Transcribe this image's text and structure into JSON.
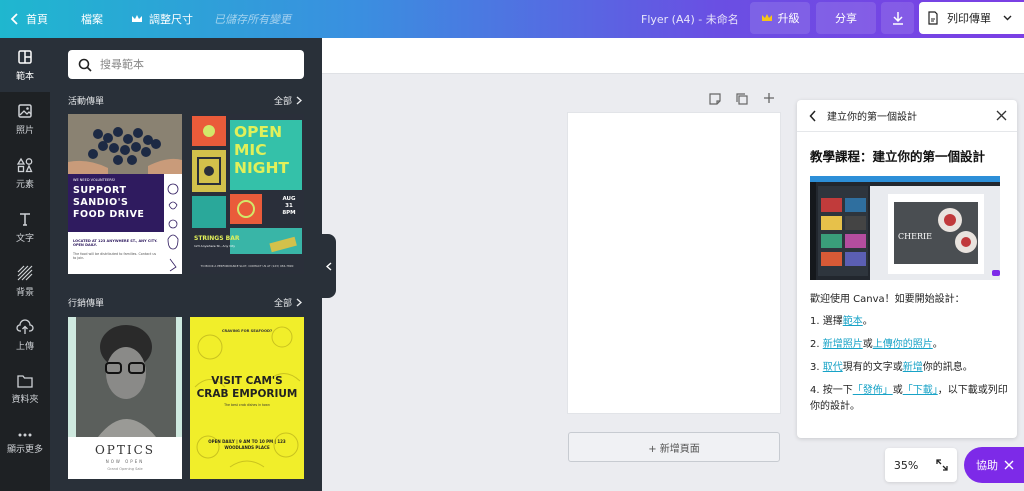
{
  "topbar": {
    "home": "首頁",
    "file": "檔案",
    "resize": "調整尺寸",
    "saved_status": "已儲存所有變更",
    "doc_title": "Flyer (A4) - 未命名",
    "upgrade": "升級",
    "share": "分享",
    "print": "列印傳單"
  },
  "rail": [
    {
      "label": "範本",
      "icon": "templates-icon"
    },
    {
      "label": "照片",
      "icon": "photos-icon"
    },
    {
      "label": "元素",
      "icon": "elements-icon"
    },
    {
      "label": "文字",
      "icon": "text-icon"
    },
    {
      "label": "背景",
      "icon": "background-icon"
    },
    {
      "label": "上傳",
      "icon": "upload-icon"
    },
    {
      "label": "資料夾",
      "icon": "folder-icon"
    },
    {
      "label": "顯示更多",
      "icon": "more-icon"
    }
  ],
  "panel": {
    "search_placeholder": "搜尋範本",
    "sections": [
      {
        "title": "活動傳單",
        "all": "全部"
      },
      {
        "title": "行銷傳單",
        "all": "全部"
      }
    ],
    "templates": {
      "food_drive": {
        "kicker": "WE NEED VOLUNTEERS!",
        "title": "SUPPORT SANDIO'S FOOD DRIVE",
        "located": "LOCATED AT 123 ANYWHERE ST., ANY CITY. OPEN DAILY.",
        "body": "The food will be distributed to families. Contact us to join."
      },
      "open_mic": {
        "title": "OPEN MIC NIGHT",
        "date": "AUG 31 8PM",
        "venue": "STRINGS BAR",
        "address": "123 Anywhere St., Any City",
        "footer": "TO BOOK A PERFORMANCE SLOT, CONTACT US AT (123) 456-7890"
      },
      "optics": {
        "title": "OPTICS",
        "subtitle": "NOW OPEN",
        "body": "Grand Opening Sale"
      },
      "crab": {
        "kicker": "CRAVING FOR SEAFOOD?",
        "title": "VISIT CAM'S CRAB EMPORIUM",
        "hours": "OPEN DAILY | 9 AM TO 10 PM | 123 WOODLANDS PLACE",
        "body": "The best crab dishes in town"
      }
    }
  },
  "canvas": {
    "add_page": "+ 新增頁面"
  },
  "help": {
    "header": "建立你的第一個設計",
    "title": "教學課程：建立你的第一個設計",
    "shot_caption": "CHERIE",
    "intro": "歡迎使用 Canva！如要開始設計：",
    "step1": {
      "pre": "1. 選擇",
      "link": "範本",
      "post": "。"
    },
    "step2": {
      "pre": "2. ",
      "link1": "新增照片",
      "mid": "或",
      "link2": "上傳你的照片",
      "post": "。"
    },
    "step3": {
      "pre": "3. ",
      "link1": "取代",
      "mid": "現有的文字或",
      "link2": "新增",
      "post": "你的訊息。"
    },
    "step4": {
      "pre": "4. 按一下",
      "link1": "「發佈」",
      "mid": "或",
      "link2": "「下載」",
      "post": "，以下載或列印你的設計。"
    }
  },
  "zoom": {
    "level": "35%"
  },
  "assist": {
    "label": "協助"
  },
  "colors": {
    "accent": "#7d2ae8",
    "link": "#18a3c7",
    "panel": "#293039",
    "rail": "#1e2124"
  }
}
